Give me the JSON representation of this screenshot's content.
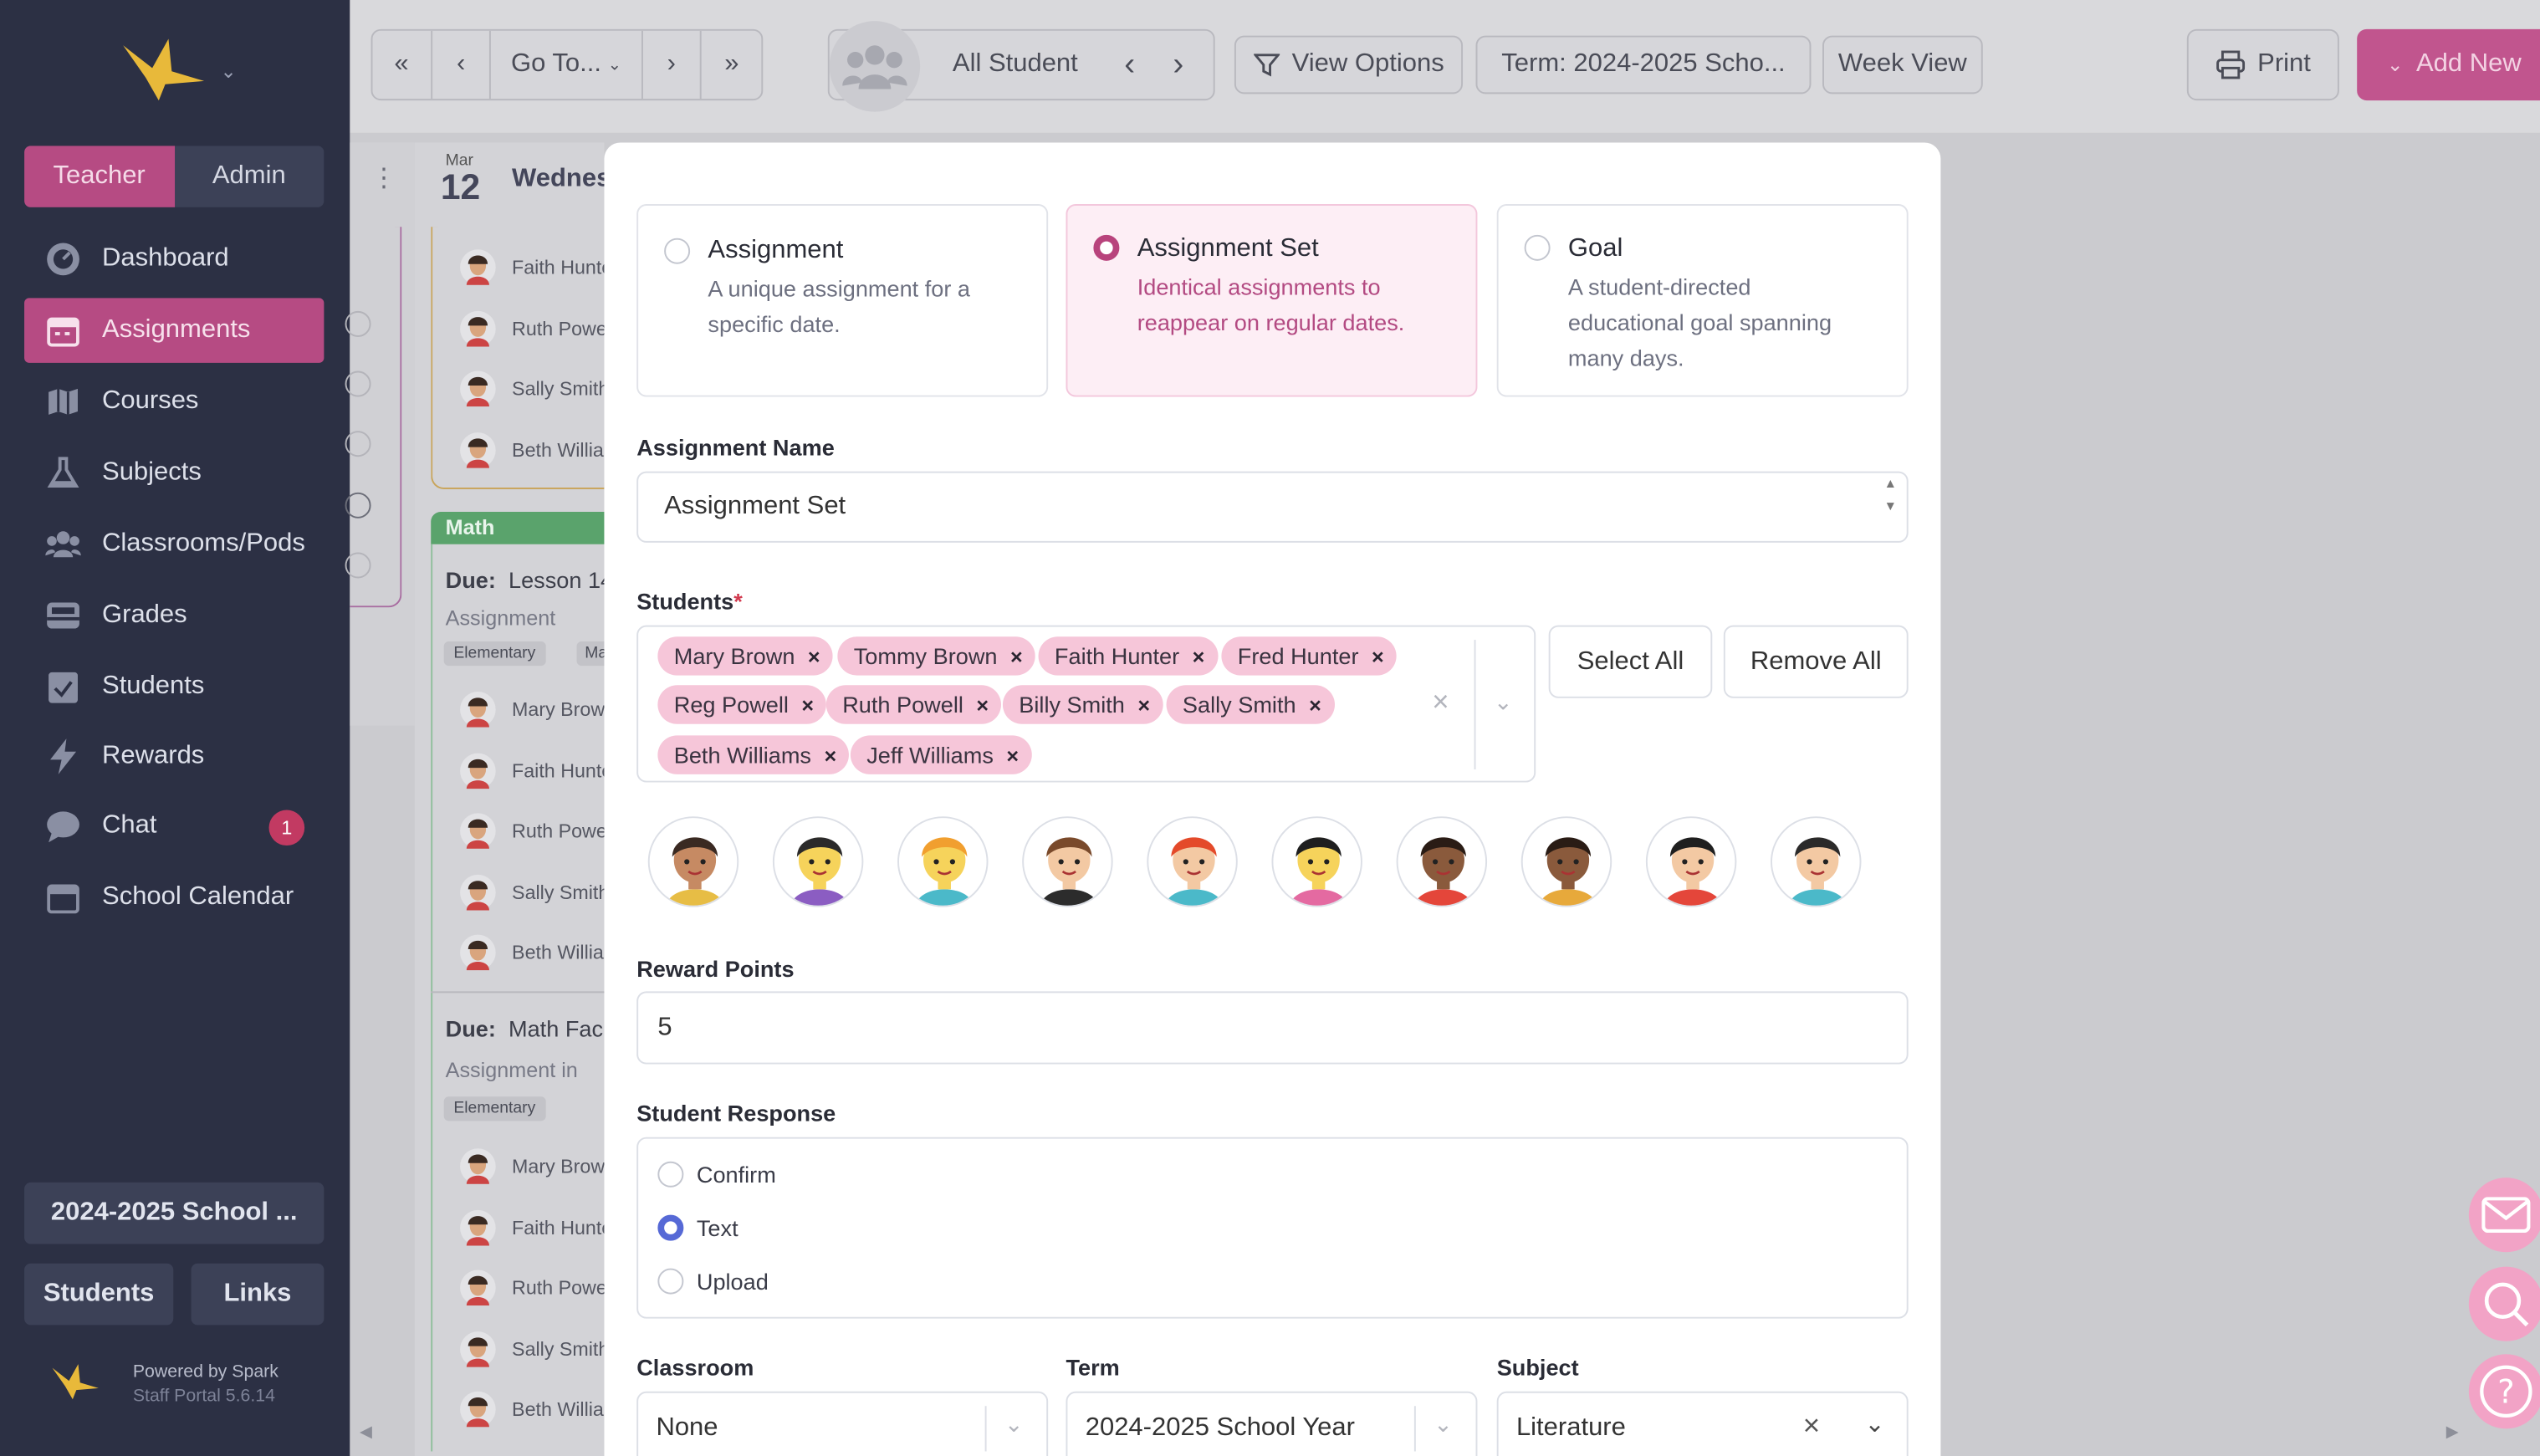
{
  "sidebar": {
    "roles": [
      "Teacher",
      "Admin"
    ],
    "nav": [
      {
        "label": "Dashboard",
        "icon": "dashboard-icon"
      },
      {
        "label": "Assignments",
        "icon": "calendar-icon",
        "active": true
      },
      {
        "label": "Courses",
        "icon": "map-icon"
      },
      {
        "label": "Subjects",
        "icon": "flask-icon"
      },
      {
        "label": "Classrooms/Pods",
        "icon": "users-icon"
      },
      {
        "label": "Grades",
        "icon": "inbox-icon"
      },
      {
        "label": "Students",
        "icon": "clipboard-check-icon"
      },
      {
        "label": "Rewards",
        "icon": "bolt-icon"
      },
      {
        "label": "Chat",
        "icon": "chat-icon",
        "badge": "1"
      },
      {
        "label": "School Calendar",
        "icon": "calendar-blank-icon"
      }
    ],
    "year_button": "2024-2025 School ...",
    "students_button": "Students",
    "links_button": "Links",
    "powered_by": "Powered by Spark",
    "version": "Staff Portal 5.6.14"
  },
  "topbar": {
    "goto_label": "Go To...",
    "student_filter": "All Student",
    "view_options": "View Options",
    "term": "Term: 2024-2025 Scho...",
    "week_view": "Week View",
    "print": "Print",
    "add_new": "Add New"
  },
  "calendar": {
    "month": "Mar",
    "day": "12",
    "weekday": "Wednes",
    "group_label": "Math",
    "students_top": [
      "Faith Hunte",
      "Ruth Powe",
      "Sally Smith",
      "Beth Willia"
    ],
    "due1": {
      "prefix": "Due:",
      "title": "Lesson 14",
      "type": "Assignment",
      "tag": "Elementary",
      "tag2": "Ma"
    },
    "students_mid": [
      "Mary Brow",
      "Faith Hunte",
      "Ruth Powe",
      "Sally Smith",
      "Beth Willia"
    ],
    "due2": {
      "prefix": "Due:",
      "title": "Math Fac",
      "type": "Assignment in",
      "tag": "Elementary"
    },
    "students_bottom": [
      "Mary Brow",
      "Faith Hunte",
      "Ruth Powe",
      "Sally Smith",
      "Beth Willia"
    ]
  },
  "modal": {
    "types": [
      {
        "title": "Assignment",
        "desc_lines": [
          "A unique assignment for a",
          "specific date."
        ]
      },
      {
        "title": "Assignment Set",
        "desc_lines": [
          "Identical assignments to",
          "reappear on regular dates."
        ],
        "selected": true
      },
      {
        "title": "Goal",
        "desc_lines": [
          "A student-directed",
          "educational goal spanning",
          "many days."
        ]
      }
    ],
    "assignment_name_label": "Assignment Name",
    "assignment_name_value": "Assignment Set",
    "students_label": "Students",
    "students_required": "*",
    "chips": [
      "Mary Brown",
      "Tommy Brown",
      "Faith Hunter",
      "Fred Hunter",
      "Reg Powell",
      "Ruth Powell",
      "Billy Smith",
      "Sally Smith",
      "Beth Williams",
      "Jeff Williams"
    ],
    "chip_remove": "×",
    "select_all": "Select All",
    "remove_all": "Remove All",
    "reward_points_label": "Reward Points",
    "reward_points_value": "5",
    "student_response_label": "Student Response",
    "responses": [
      {
        "label": "Confirm",
        "checked": false
      },
      {
        "label": "Text",
        "checked": true
      },
      {
        "label": "Upload",
        "checked": false
      }
    ],
    "classroom_label": "Classroom",
    "classroom_value": "None",
    "term_label": "Term",
    "term_value": "2024-2025 School Year",
    "subject_label": "Subject",
    "subject_value": "Literature"
  },
  "colors": {
    "sidebar_bg": "#2c3044",
    "accent": "#b64b83",
    "chip_bg": "#f6c6d9",
    "add_new": "#c1558e",
    "math_green": "#5aa36c",
    "fab_pink": "#f2a3c6"
  }
}
